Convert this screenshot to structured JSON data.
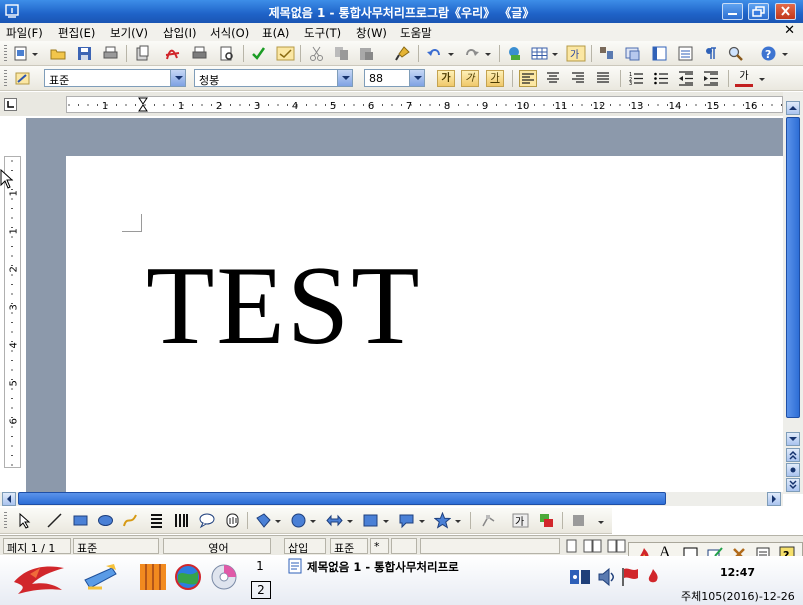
{
  "window": {
    "title": "제목없음 1 - 통합사무처리프로그람《우리》 《글》"
  },
  "menu": {
    "items": [
      "파일(F)",
      "편집(E)",
      "보기(V)",
      "삽입(I)",
      "서식(O)",
      "표(A)",
      "도구(T)",
      "창(W)",
      "도움말"
    ],
    "close_glyph": "✕"
  },
  "format_bar": {
    "style_value": "표준",
    "font_value": "청봉",
    "size_value": "88",
    "bold_glyph": "가",
    "italic_glyph": "가",
    "underline_glyph": "가",
    "font_color_glyph": "가"
  },
  "ruler": {
    "h_labels": [
      "1",
      "1",
      "2",
      "3",
      "4",
      "5",
      "6",
      "7",
      "8",
      "9",
      "10",
      "11",
      "12",
      "13",
      "14",
      "15",
      "16"
    ],
    "v_labels": [
      "1",
      "1",
      "2",
      "3",
      "4",
      "5",
      "6"
    ]
  },
  "document": {
    "text": "TEST"
  },
  "statusbar": {
    "page": "페지 1 / 1",
    "style": "표준",
    "language": "영어",
    "insert_mode": "삽입",
    "view": "표준",
    "marker": "*"
  },
  "taskbar": {
    "workspaces": [
      "1",
      "2"
    ],
    "task_title": "제목없음 1 - 통합사무처리프로",
    "clock": "12:47",
    "date": "주체105(2016)-12-26"
  },
  "ime": {
    "letter": "A"
  },
  "colors": {
    "titlebar": "#1f63c8",
    "doc_bg": "#8c99ab",
    "scroll_thumb": "#2e6ed6"
  }
}
